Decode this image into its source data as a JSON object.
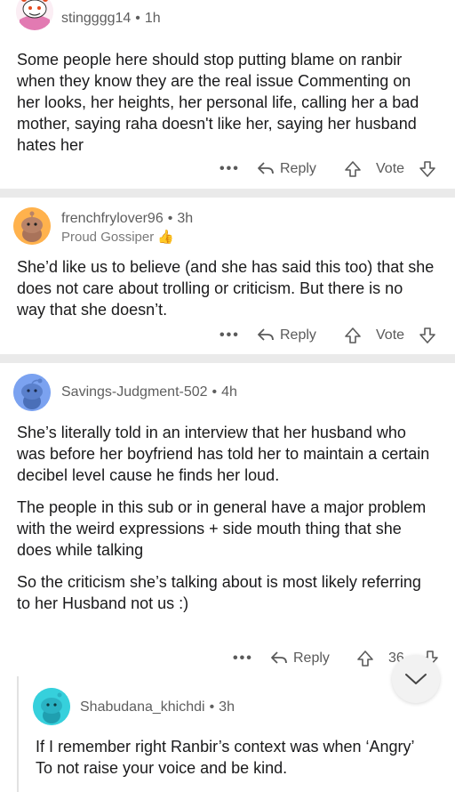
{
  "comments": [
    {
      "username": "stingggg14",
      "time": "1h",
      "flair": "",
      "paragraphs": [
        "Some people here should stop putting blame on ranbir when they know they are the real issue Commenting on her looks, her heights, her personal life, calling her a bad mother, saying raha doesn't like her, saying her husband hates her"
      ],
      "more_label": "•••",
      "reply_label": "Reply",
      "vote_label": "Vote"
    },
    {
      "username": "frenchfrylover96",
      "time": "3h",
      "flair": "Proud Gossiper 👍",
      "paragraphs": [
        "She’d like us to believe (and she has said this too) that she does not care about trolling or criticism. But there is no way that she doesn’t."
      ],
      "more_label": "•••",
      "reply_label": "Reply",
      "vote_label": "Vote"
    },
    {
      "username": "Savings-Judgment-502",
      "time": "4h",
      "flair": "",
      "paragraphs": [
        "She’s literally told in an interview that her husband who was before her boyfriend has told her to maintain a certain decibel level cause he finds her loud.",
        "The people in this sub or in general have a major problem with the weird expressions + side mouth thing that she does while talking",
        "So the criticism she’s talking about is most likely referring to her Husband not us :)"
      ],
      "more_label": "•••",
      "reply_label": "Reply",
      "vote_label": "36"
    },
    {
      "username": "Shabudana_khichdi",
      "time": "3h",
      "flair": "",
      "paragraphs": [
        "If I remember right Ranbir’s context was when ‘Angry’ To not raise your voice and be kind."
      ]
    }
  ],
  "dot_separator": "•",
  "icons": {
    "reply": "reply-arrow-icon",
    "upvote": "upvote-arrow-icon",
    "downvote": "downvote-arrow-icon",
    "more": "more-dots-icon",
    "scroll_down": "chevron-down-icon"
  }
}
